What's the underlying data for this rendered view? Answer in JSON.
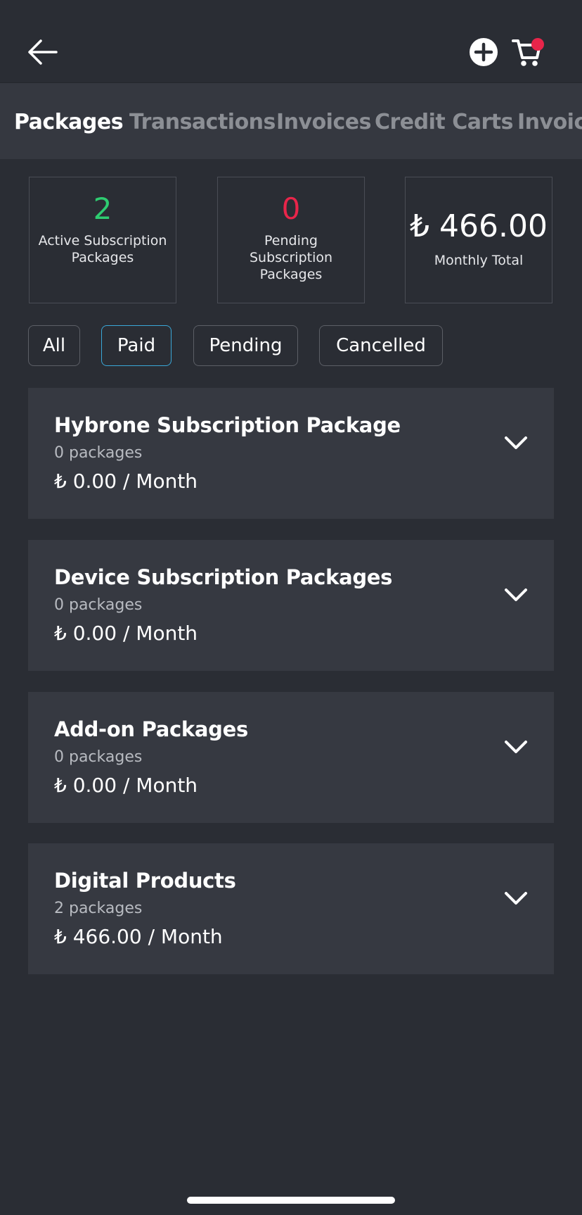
{
  "header": {
    "back_icon": "arrow-left-icon",
    "add_icon": "plus-circle-icon",
    "cart_icon": "shopping-cart-icon",
    "cart_badge_color": "#e8254a"
  },
  "tabs": [
    {
      "label": "Packages",
      "active": true
    },
    {
      "label": "Transactions",
      "active": false
    },
    {
      "label": "Invoices",
      "active": false
    },
    {
      "label": "Credit Carts",
      "active": false
    },
    {
      "label": "Invoices",
      "active": false
    }
  ],
  "stats": {
    "active": {
      "value": "2",
      "label": "Active Subscription Packages",
      "color": "#2ecc71"
    },
    "pending": {
      "value": "0",
      "label": "Pending Subscription Packages",
      "color": "#e8254a"
    },
    "total": {
      "value": "₺ 466.00",
      "label": "Monthly Total"
    }
  },
  "filters": {
    "all": "All",
    "paid": "Paid",
    "pending": "Pending",
    "cancelled": "Cancelled",
    "selected": "Paid",
    "selected_color": "#3aa7d8"
  },
  "packages": [
    {
      "title": "Hybrone Subscription Package",
      "count": "0 packages",
      "price": "₺ 0.00 / Month"
    },
    {
      "title": "Device Subscription Packages",
      "count": "0 packages",
      "price": "₺ 0.00 / Month"
    },
    {
      "title": "Add-on Packages",
      "count": "0 packages",
      "price": "₺ 0.00 / Month"
    },
    {
      "title": "Digital Products",
      "count": "2 packages",
      "price": "₺ 466.00 / Month"
    }
  ]
}
